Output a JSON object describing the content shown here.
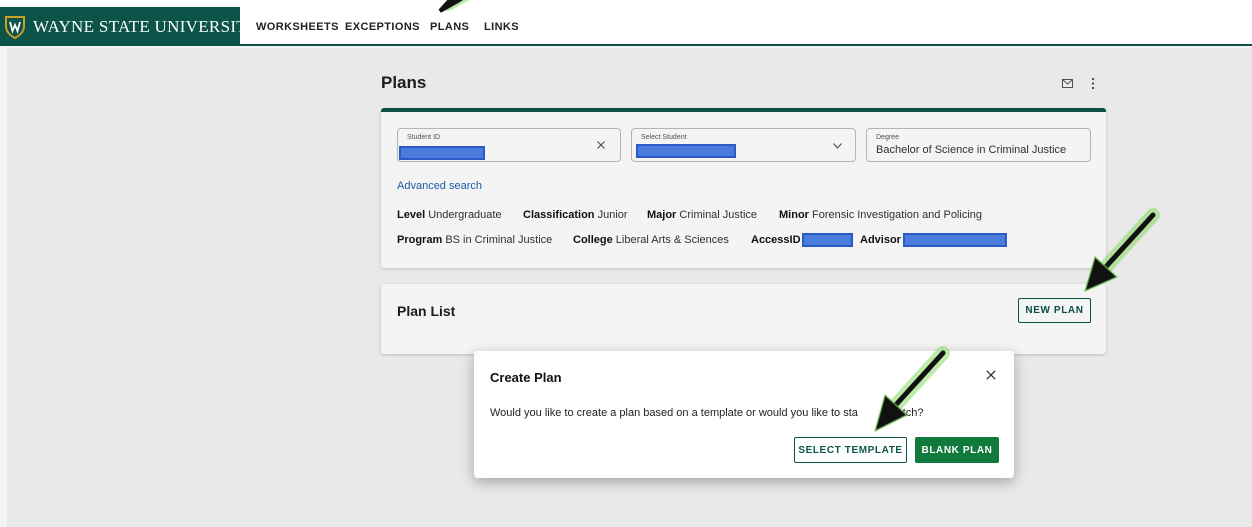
{
  "brand": {
    "name": "WAYNE STATE UNIVERSITY",
    "logo_icon": "shield-w-logo",
    "color": "#0c5449"
  },
  "nav": {
    "items": [
      {
        "label": "WORKSHEETS"
      },
      {
        "label": "EXCEPTIONS"
      },
      {
        "label": "PLANS"
      },
      {
        "label": "LINKS"
      }
    ]
  },
  "page": {
    "title": "Plans",
    "icons": [
      "mail-icon",
      "kebab-menu-icon"
    ]
  },
  "search": {
    "student_id": {
      "label": "Student ID",
      "value": ""
    },
    "select_student": {
      "label": "Select Student",
      "value": ""
    },
    "degree": {
      "label": "Degree",
      "value": "Bachelor of Science in Criminal Justice"
    },
    "advanced_search": "Advanced search"
  },
  "student_info": {
    "level_label": "Level",
    "level": "Undergraduate",
    "classification_label": "Classification",
    "classification": "Junior",
    "major_label": "Major",
    "major": "Criminal Justice",
    "minor_label": "Minor",
    "minor": "Forensic Investigation and Policing",
    "program_label": "Program",
    "program": "BS in Criminal Justice",
    "college_label": "College",
    "college": "Liberal Arts & Sciences",
    "accessid_label": "AccessID",
    "accessid": "",
    "advisor_label": "Advisor",
    "advisor": ""
  },
  "plan_list": {
    "title": "Plan List",
    "new_plan_label": "NEW PLAN"
  },
  "dialog": {
    "title": "Create Plan",
    "message": "Would you like to create a plan based on a template or would you like to sta",
    "message_tail": "scratch?",
    "select_template_label": "SELECT TEMPLATE",
    "blank_plan_label": "BLANK PLAN"
  },
  "colors": {
    "primary": "#0c5449",
    "button_green": "#0f7a3c",
    "link": "#1f5fae",
    "redaction": "#4d82e6",
    "arrow_glow": "#7ed957"
  }
}
